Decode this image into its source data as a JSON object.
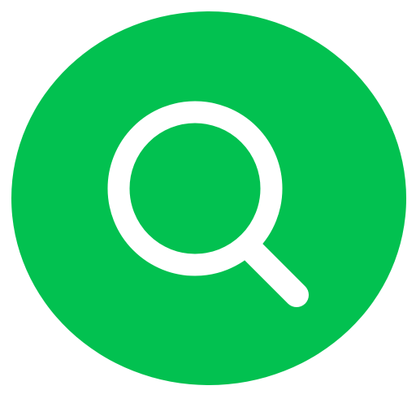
{
  "search_button": {
    "icon": "search-icon",
    "background_color": "#02c150",
    "icon_color": "#ffffff"
  }
}
